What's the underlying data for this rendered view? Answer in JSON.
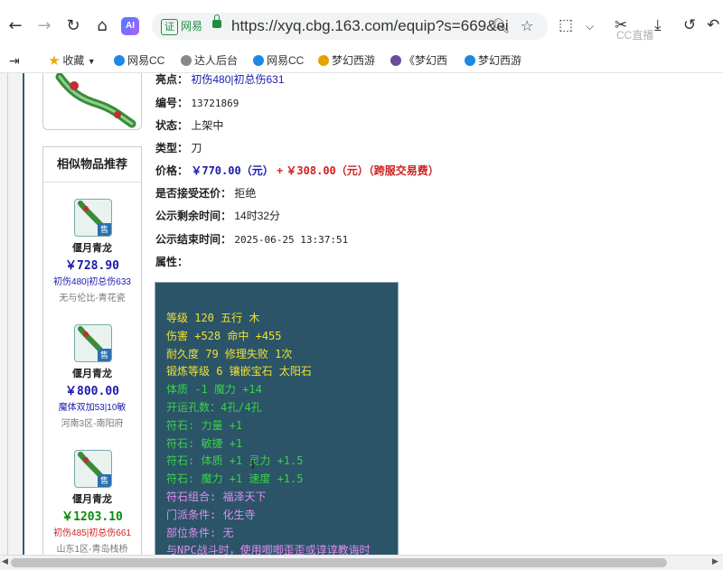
{
  "browser": {
    "url": "https://xyq.cbg.163.com/equip?s=669&ei",
    "cert_label": "证",
    "cert_name": "网易",
    "watermark": "CC直播",
    "ai_label": "AI"
  },
  "bookmarks": [
    {
      "label": "收藏",
      "color": "#f0a500"
    },
    {
      "label": "网易CC",
      "color": "#1e88e5"
    },
    {
      "label": "达人后台",
      "color": "#888888"
    },
    {
      "label": "网易CC",
      "color": "#1e88e5"
    },
    {
      "label": "梦幻西游",
      "color": "#e6a100"
    },
    {
      "label": "《梦幻西",
      "color": "#6a4c9c"
    },
    {
      "label": "梦幻西游",
      "color": "#1e88e5"
    }
  ],
  "item": {
    "highlight_label": "亮点：",
    "highlight_value": "初伤480|初总伤631",
    "id_label": "编号：",
    "id_value": "13721869",
    "status_label": "状态：",
    "status_value": "上架中",
    "type_label": "类型：",
    "type_value": "刀",
    "price_label": "价格：",
    "price_value": "￥770.00（元）",
    "price_plus": "+",
    "price_fee": "￥308.00（元）（跨服交易费）",
    "bargain_label": "是否接受还价：",
    "bargain_value": "拒绝",
    "remain_label": "公示剩余时间：",
    "remain_value": "14时32分",
    "end_label": "公示结束时间：",
    "end_value": "2025-06-25 13:37:51",
    "attr_label": "属性："
  },
  "attributes": [
    {
      "text": "等级 120 五行 木",
      "color": "#f0e030"
    },
    {
      "text": "伤害 +528 命中 +455",
      "color": "#f0e030"
    },
    {
      "text": "耐久度 79 修理失败 1次",
      "color": "#f0e030"
    },
    {
      "text": "锻炼等级 6 镶嵌宝石 太阳石",
      "color": "#f0e030"
    },
    {
      "text": "体质 -1 魔力 +14",
      "color": "#3ad14a"
    },
    {
      "text": "开运孔数：4孔/4孔",
      "color": "#3ad14a"
    },
    {
      "text": "符石: 力量 +1",
      "color": "#3ad14a"
    },
    {
      "text": "符石: 敏捷 +1",
      "color": "#3ad14a"
    },
    {
      "text": "符石: 体质 +1 灵力 +1.5",
      "color": "#3ad14a"
    },
    {
      "text": "符石: 魔力 +1 速度 +1.5",
      "color": "#3ad14a"
    },
    {
      "text": "符石组合: 福泽天下",
      "color": "#e28cf0"
    },
    {
      "text": "门派条件: 化生寺",
      "color": "#e28cf0"
    },
    {
      "text": "部位条件: 无",
      "color": "#e28cf0"
    },
    {
      "text": "与NPC战斗时，使用唧唧歪歪或谆谆教诲时",
      "color": "#e28cf0"
    }
  ],
  "similar": {
    "title": "相似物品推荐",
    "sale_badge": "售",
    "items": [
      {
        "name": "偃月青龙",
        "price": "￥728.90",
        "price_color": "#1a1aaa",
        "attr": "初伤480|初总伤633",
        "attr_color": "#1a1aaa",
        "server": "无与伦比-青花瓷"
      },
      {
        "name": "偃月青龙",
        "price": "￥800.00",
        "price_color": "#1a1aaa",
        "attr": "魔体双加53|10敏",
        "attr_color": "#1a1aaa",
        "server": "河南3区-南阳府"
      },
      {
        "name": "偃月青龙",
        "price": "￥1203.10",
        "price_color": "#0a8a0a",
        "attr": "初伤485|初总伤661",
        "attr_color": "#d02020",
        "server": "山东1区-青岛栈桥"
      }
    ]
  },
  "colors": {
    "price": "#d02020",
    "highlight": "#1a1aaa",
    "attr_bg": "#2b5468"
  }
}
